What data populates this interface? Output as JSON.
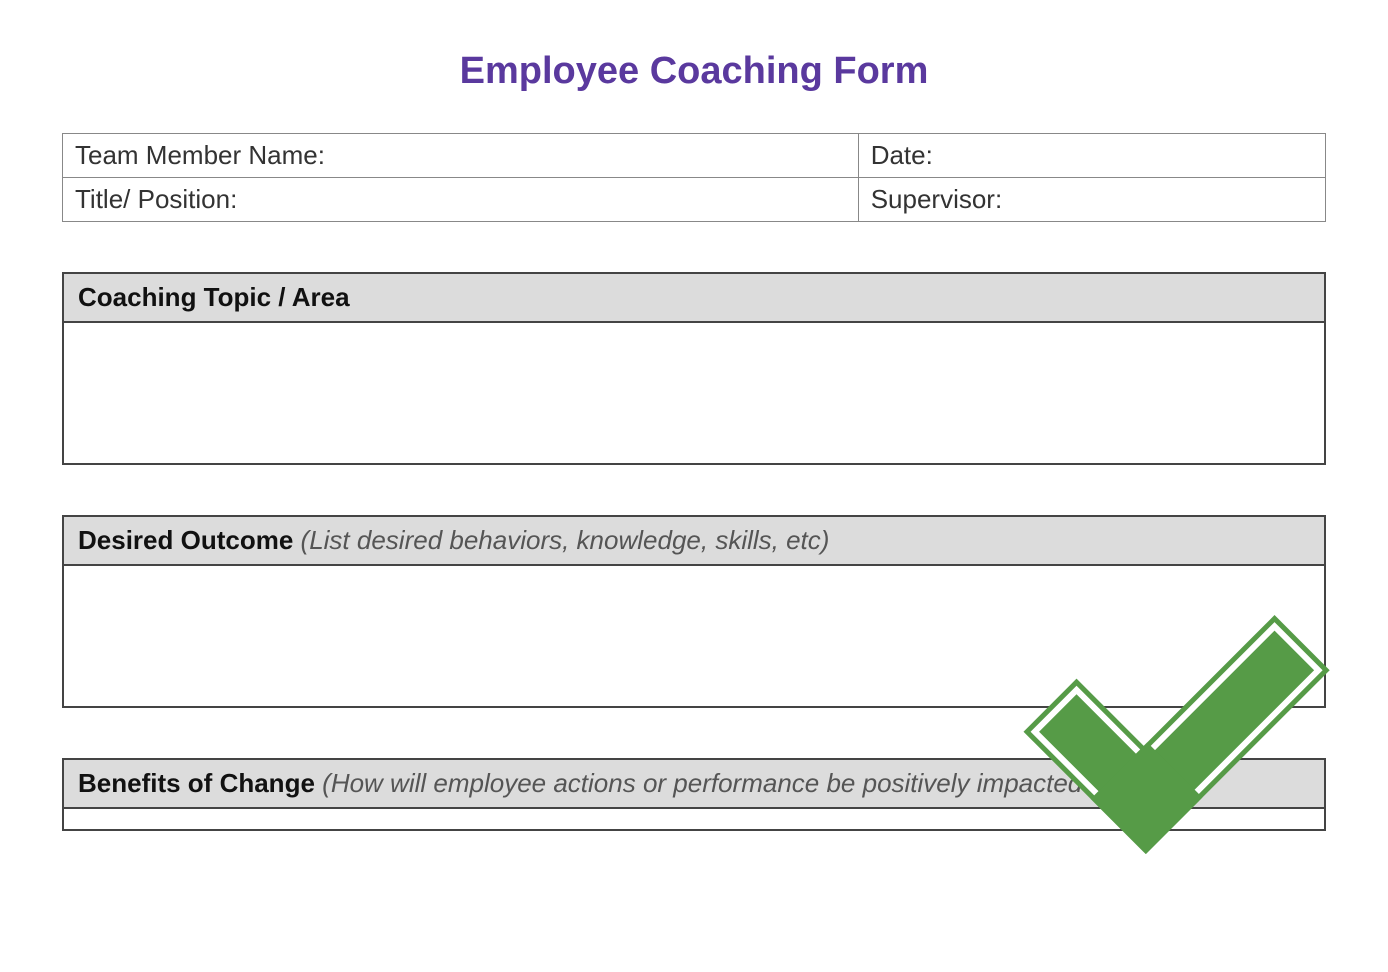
{
  "title": "Employee Coaching Form",
  "info_fields": {
    "team_member_name": "Team Member Name:",
    "date": "Date:",
    "title_position": "Title/ Position:",
    "supervisor": "Supervisor:"
  },
  "sections": {
    "coaching_topic": {
      "label": "Coaching Topic / Area",
      "subtext": ""
    },
    "desired_outcome": {
      "label": "Desired Outcome",
      "subtext": "(List desired behaviors, knowledge, skills, etc)"
    },
    "benefits_of_change": {
      "label": "Benefits of Change",
      "subtext": "(How will employee actions or performance be positively impacted?)"
    }
  }
}
